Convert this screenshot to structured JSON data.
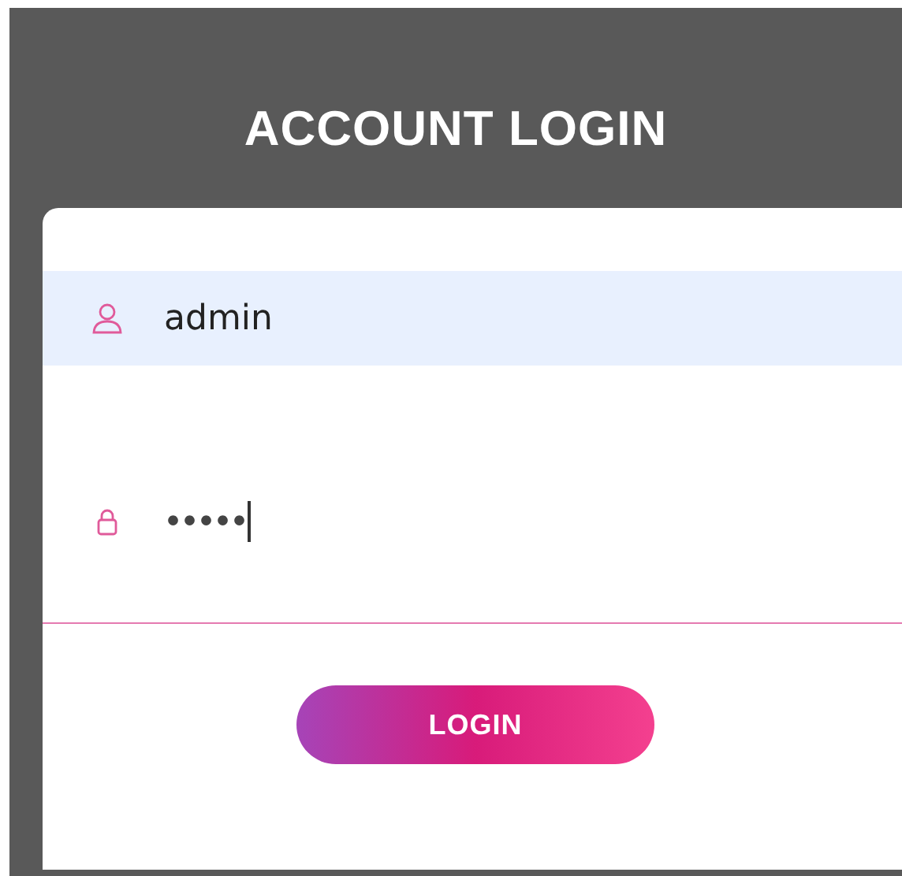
{
  "title": "ACCOUNT LOGIN",
  "fields": [
    {
      "kind": "user",
      "value": "admin",
      "highlighted": true,
      "focused": false
    },
    {
      "kind": "password",
      "value": "•••••",
      "highlighted": false,
      "focused": true
    }
  ],
  "button": "LOGIN"
}
